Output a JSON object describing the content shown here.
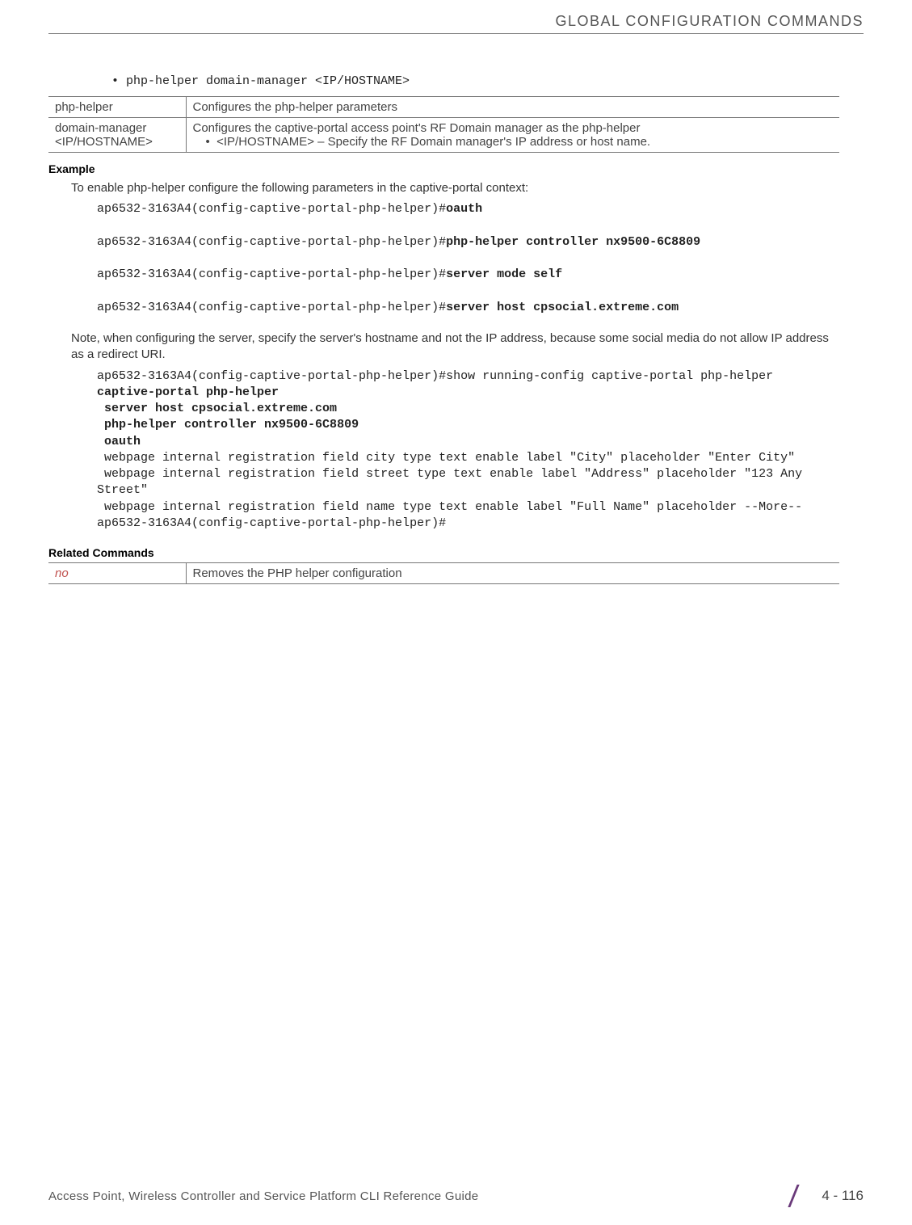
{
  "header": {
    "running_title": "GLOBAL CONFIGURATION COMMANDS"
  },
  "syntax": {
    "line": "• php-helper domain-manager <IP/HOSTNAME>"
  },
  "param_table": {
    "rows": [
      {
        "key": "php-helper",
        "desc": "Configures the php-helper parameters"
      },
      {
        "key": "domain-manager <IP/HOSTNAME>",
        "desc": "Configures the captive-portal access point's RF Domain manager as the php-helper",
        "bullet": "<IP/HOSTNAME> – Specify the RF Domain manager's IP address or host name."
      }
    ]
  },
  "example": {
    "heading": "Example",
    "intro": "To enable php-helper configure the following parameters in the captive-portal context:",
    "block1_plain": "ap6532-3163A4(config-captive-portal-php-helper)#",
    "block1_bold": "oauth",
    "block2_plain": "ap6532-3163A4(config-captive-portal-php-helper)#",
    "block2_bold": "php-helper controller nx9500-6C8809",
    "block3_plain": "ap6532-3163A4(config-captive-portal-php-helper)#",
    "block3_bold": "server mode self",
    "block4_plain": "ap6532-3163A4(config-captive-portal-php-helper)#",
    "block4_bold": "server host cpsocial.extreme.com",
    "note": "Note, when configuring the server, specify the server's hostname and not the IP address, because some social media do not allow IP address as a redirect URI.",
    "block5_pre": "ap6532-3163A4(config-captive-portal-php-helper)#show running-config captive-portal php-helper",
    "block5_bold": "captive-portal php-helper\n server host cpsocial.extreme.com\n php-helper controller nx9500-6C8809\n oauth",
    "block5_post": " webpage internal registration field city type text enable label \"City\" placeholder \"Enter City\"\n webpage internal registration field street type text enable label \"Address\" placeholder \"123 Any Street\"\n webpage internal registration field name type text enable label \"Full Name\" placeholder --More--\nap6532-3163A4(config-captive-portal-php-helper)#"
  },
  "related": {
    "heading": "Related Commands",
    "rows": [
      {
        "key": "no",
        "desc": "Removes the PHP helper configuration"
      }
    ]
  },
  "footer": {
    "left": "Access Point, Wireless Controller and Service Platform CLI Reference Guide",
    "page": "4 - 116"
  }
}
